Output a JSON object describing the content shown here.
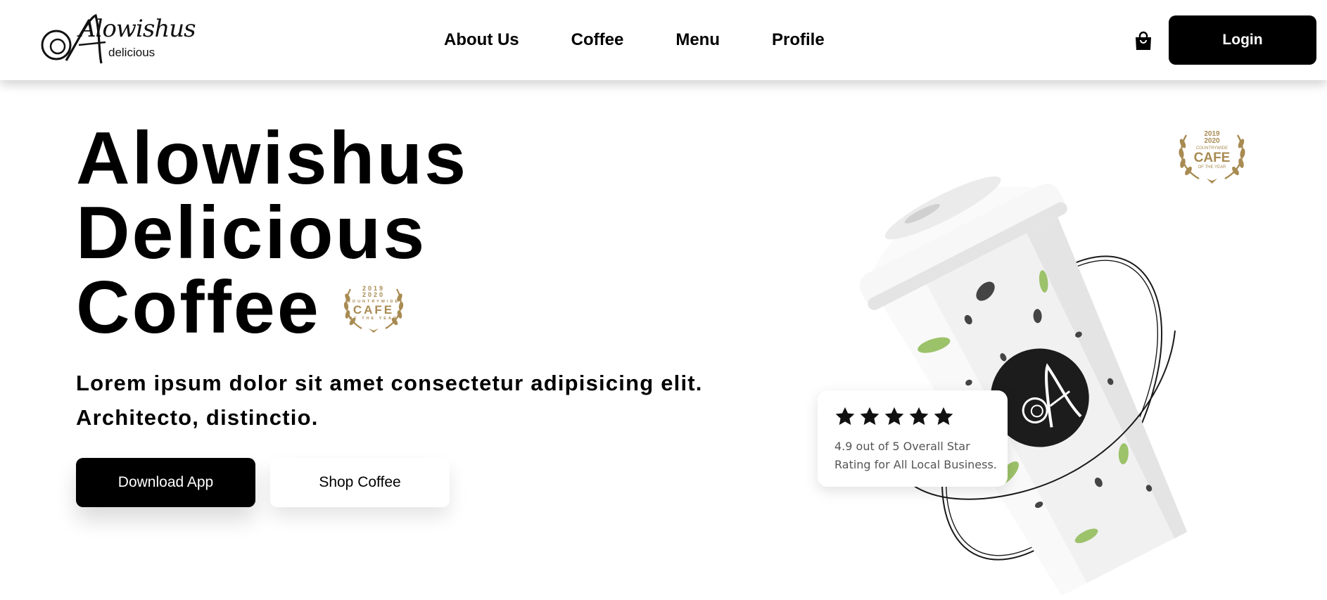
{
  "header": {
    "logo": {
      "script_text": "Alowishus",
      "subtitle": "delicious"
    },
    "nav": [
      {
        "label": "About Us"
      },
      {
        "label": "Coffee"
      },
      {
        "label": "Menu"
      },
      {
        "label": "Profile"
      }
    ],
    "cart_icon": "shopping-bag-icon",
    "login_label": "Login"
  },
  "hero": {
    "title_lines": [
      "Alowishus",
      "Delicious",
      "Coffee"
    ],
    "description": "Lorem ipsum dolor sit amet consectetur adipisicing elit. Architecto, distinctio.",
    "buttons": {
      "download": "Download App",
      "shop": "Shop Coffee"
    }
  },
  "award_badge": {
    "years": "2019\n2020",
    "line1": "COUNTRYWIDE",
    "main": "CAFE",
    "line2": "OF THE YEAR",
    "color": "#A88B52"
  },
  "rating_card": {
    "stars": 5,
    "text": "4.9 out of 5 Overall Star Rating for All Local Business."
  },
  "colors": {
    "primary": "#000000",
    "background": "#FFFFFF",
    "leaf_green": "#9CC26A",
    "badge_gold": "#A88B52"
  }
}
